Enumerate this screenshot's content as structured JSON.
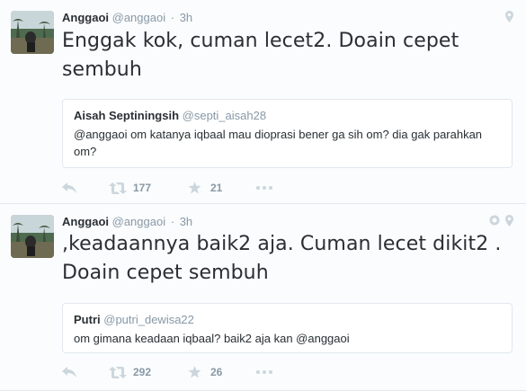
{
  "tweets": [
    {
      "author_name": "Anggaoi",
      "author_handle": "@anggaoi",
      "separator": "·",
      "time": "3h",
      "text": "Enggak kok, cuman lecet2. Doain cepet sembuh",
      "quote": {
        "author_name": "Aisah Septiningsih",
        "author_handle": "@septi_aisah28",
        "text": "@anggaoi om katanya iqbaal mau dioprasi bener ga sih om? dia gak parahkan om?"
      },
      "retweets": "177",
      "favorites": "21",
      "meta_icons": [
        "location-pin-icon"
      ]
    },
    {
      "author_name": "Anggaoi",
      "author_handle": "@anggaoi",
      "separator": "·",
      "time": "3h",
      "text": ",keadaannya baik2 aja. Cuman lecet dikit2 . Doain cepet sembuh",
      "quote": {
        "author_name": "Putri",
        "author_handle": "@putri_dewisa22",
        "text": "om gimana keadaan iqbaal? baik2 aja kan @anggaoi"
      },
      "retweets": "292",
      "favorites": "26",
      "meta_icons": [
        "source-app-icon",
        "location-pin-icon"
      ]
    }
  ],
  "colors": {
    "text": "#292f33",
    "muted": "#8899a6",
    "border": "#e1e8ed",
    "background": "#f5f8fa"
  }
}
